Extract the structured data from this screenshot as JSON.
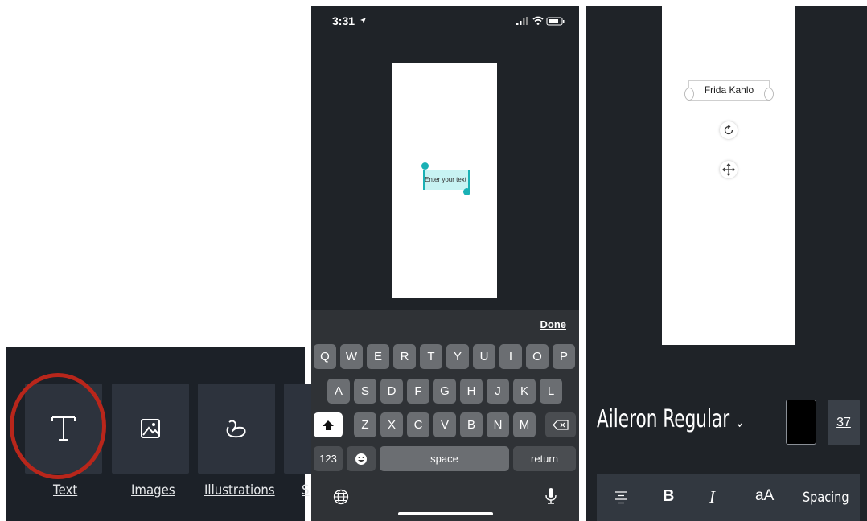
{
  "panel1": {
    "toolbar_items": [
      {
        "label": "Text",
        "icon": "text-icon"
      },
      {
        "label": "Images",
        "icon": "image-icon"
      },
      {
        "label": "Illustrations",
        "icon": "illustration-icon"
      },
      {
        "label": "S",
        "icon": "more-icon"
      }
    ],
    "highlight_color": "#b8261b"
  },
  "panel2": {
    "status_time": "3:31",
    "status_icons": [
      "location-icon",
      "signal-icon",
      "wifi-icon",
      "battery-icon"
    ],
    "text_box_placeholder": "Enter your text",
    "accent": "#1ab1b5",
    "keyboard": {
      "done": "Done",
      "row1": [
        "Q",
        "W",
        "E",
        "R",
        "T",
        "Y",
        "U",
        "I",
        "O",
        "P"
      ],
      "row2": [
        "A",
        "S",
        "D",
        "F",
        "G",
        "H",
        "J",
        "K",
        "L"
      ],
      "row3": [
        "Z",
        "X",
        "C",
        "V",
        "B",
        "N",
        "M"
      ],
      "numbers": "123",
      "space": "space",
      "return": "return"
    }
  },
  "panel3": {
    "text_element": "Frida Kahlo",
    "font_name": "Aileron Regular",
    "font_size": "37",
    "text_color": "#000000",
    "format_tools": [
      "align-icon",
      "B",
      "I",
      "aA",
      "Spacing"
    ]
  }
}
